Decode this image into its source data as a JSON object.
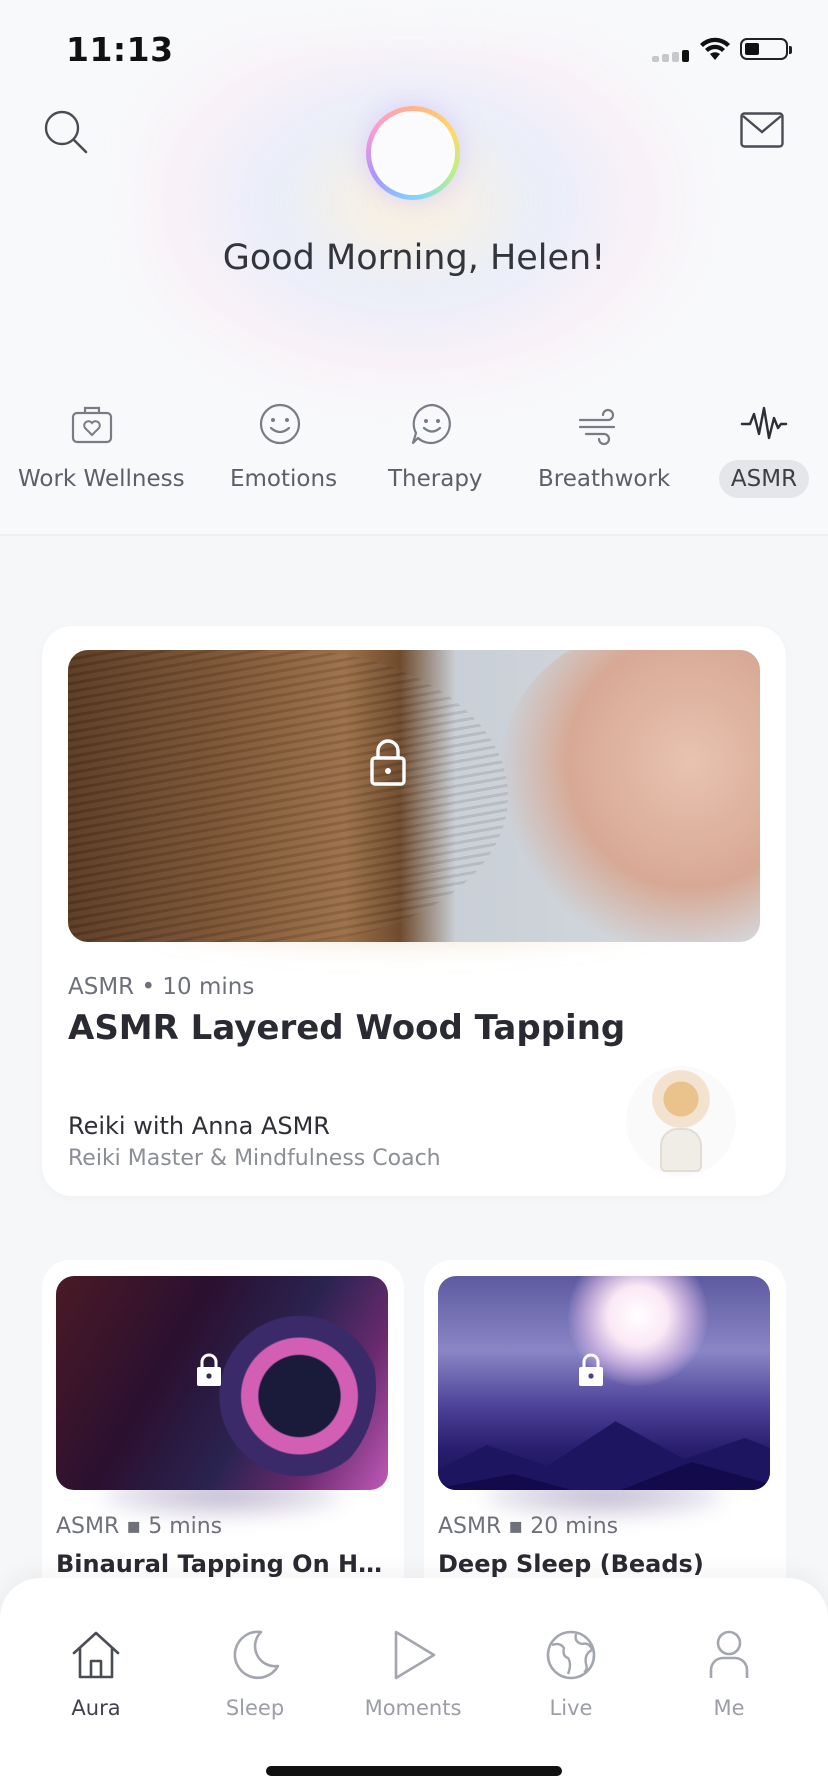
{
  "status_bar": {
    "time": "11:13"
  },
  "header": {
    "greeting": "Good Morning, Helen!"
  },
  "categories": [
    {
      "label": "Work Wellness",
      "icon": "briefcase-heart-icon"
    },
    {
      "label": "Emotions",
      "icon": "smiley-icon"
    },
    {
      "label": "Therapy",
      "icon": "chat-smiley-icon"
    },
    {
      "label": "Breathwork",
      "icon": "wind-icon"
    },
    {
      "label": "ASMR",
      "icon": "soundwave-icon",
      "selected": true
    }
  ],
  "featured": {
    "category": "ASMR",
    "duration": "10 mins",
    "title": "ASMR Layered Wood Tapping",
    "coach_name": "Reiki with Anna ASMR",
    "coach_role": "Reiki Master & Mindfulness Coach",
    "locked": true
  },
  "cards": [
    {
      "category": "ASMR",
      "duration": "5 mins",
      "title": "Binaural Tapping On Hea...",
      "locked": true
    },
    {
      "category": "ASMR",
      "duration": "20 mins",
      "title": "Deep Sleep (Beads)",
      "locked": true
    }
  ],
  "tabbar": [
    {
      "label": "Aura",
      "icon": "home-icon",
      "active": true
    },
    {
      "label": "Sleep",
      "icon": "moon-icon"
    },
    {
      "label": "Moments",
      "icon": "play-icon"
    },
    {
      "label": "Live",
      "icon": "globe-icon"
    },
    {
      "label": "Me",
      "icon": "person-icon"
    }
  ],
  "colors": {
    "accent_text": "#2a2a32",
    "muted_text": "#8c8e96",
    "selected_pill": "#e4e6ea"
  }
}
